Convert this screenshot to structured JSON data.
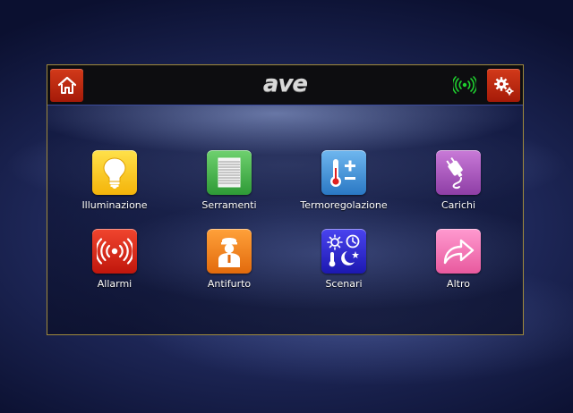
{
  "header": {
    "logo_text": "ave",
    "home_icon": "home-icon",
    "settings_icon": "gear-icon",
    "status_icon": "wireless-signal-icon",
    "status_color": "#1fcf2f"
  },
  "colors": {
    "header_button": "#c0260f",
    "panel_border": "#a08a3c"
  },
  "tiles": [
    {
      "label": "Illuminazione",
      "icon": "lightbulb-icon",
      "color": "#f8c21c"
    },
    {
      "label": "Serramenti",
      "icon": "shutter-icon",
      "color": "#3fae45"
    },
    {
      "label": "Termoregolazione",
      "icon": "thermometer-icon",
      "color": "#3a8fdc"
    },
    {
      "label": "Carichi",
      "icon": "plug-icon",
      "color": "#a64fbe"
    },
    {
      "label": "Allarmi",
      "icon": "alarm-signal-icon",
      "color": "#d8230f"
    },
    {
      "label": "Antifurto",
      "icon": "guard-icon",
      "color": "#f08218"
    },
    {
      "label": "Scenari",
      "icon": "scenarios-icon",
      "color": "#2a23d8"
    },
    {
      "label": "Altro",
      "icon": "forward-arrow-icon",
      "color": "#f27ab7"
    }
  ]
}
